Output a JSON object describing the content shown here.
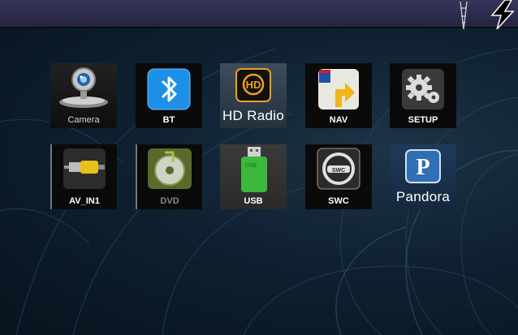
{
  "status_bar": {
    "icons": [
      "antenna-icon",
      "power-bolt-icon"
    ]
  },
  "apps": [
    {
      "label": "Camera",
      "icon": "camera-icon"
    },
    {
      "label": "BT",
      "icon": "bluetooth-icon"
    },
    {
      "label": "HD Radio",
      "icon": "hd-radio-icon"
    },
    {
      "label": "NAV",
      "icon": "navigation-sign-icon"
    },
    {
      "label": "SETUP",
      "icon": "gear-icon"
    },
    {
      "label": "AV_IN1",
      "icon": "av-plug-icon"
    },
    {
      "label": "DVD",
      "icon": "dvd-disc-icon"
    },
    {
      "label": "USB",
      "icon": "usb-drive-icon"
    },
    {
      "label": "SWC",
      "icon": "steering-wheel-icon"
    },
    {
      "label": "Pandora",
      "icon": "pandora-icon"
    }
  ],
  "colors": {
    "background": "#0f2131",
    "topbar": "#2e2e50",
    "label": "#ffffff",
    "disabled_label": "#8a8a8a",
    "bluetooth": "#1e90e8",
    "hd_orange": "#f0a020",
    "usb_green": "#3cb83c",
    "pandora_blue": "#2f6fb3"
  }
}
